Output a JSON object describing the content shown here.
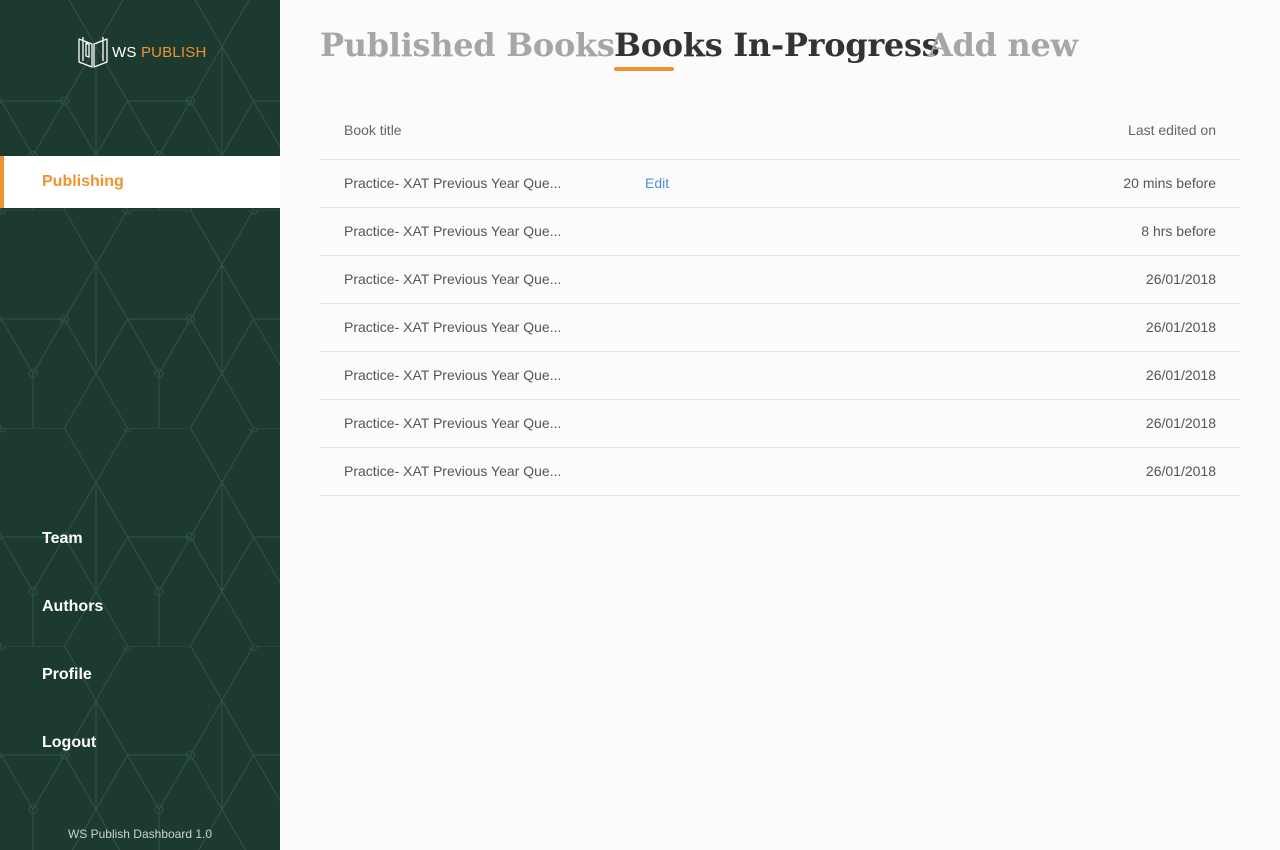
{
  "brand": {
    "logo_prefix": "WS ",
    "logo_accent": "PUBLISH",
    "logo_icon": "open-book-icon",
    "version": "WS Publish Dashboard 1.0"
  },
  "colors": {
    "sidebar": "#1c3a30",
    "accent": "#f0922e",
    "link": "#4a90e2"
  },
  "sidebar": {
    "active_item": "Publishing",
    "items": [
      "Team",
      "Authors",
      "Profile",
      "Logout"
    ]
  },
  "tabs": {
    "published": "Published Books",
    "in_progress": "Books In-Progress",
    "add_new": "Add new",
    "active": "Books In-Progress"
  },
  "table": {
    "headers": {
      "title": "Book title",
      "last_edited": "Last edited on"
    },
    "edit_label": "Edit",
    "rows": [
      {
        "title": "Practice- XAT Previous Year Que...",
        "last_edited": "20 mins before",
        "show_edit": true
      },
      {
        "title": "Practice- XAT Previous Year Que...",
        "last_edited": "8 hrs before",
        "show_edit": false
      },
      {
        "title": "Practice- XAT Previous Year Que...",
        "last_edited": "26/01/2018",
        "show_edit": false
      },
      {
        "title": "Practice- XAT Previous Year Que...",
        "last_edited": "26/01/2018",
        "show_edit": false
      },
      {
        "title": "Practice- XAT Previous Year Que...",
        "last_edited": "26/01/2018",
        "show_edit": false
      },
      {
        "title": "Practice- XAT Previous Year Que...",
        "last_edited": "26/01/2018",
        "show_edit": false
      },
      {
        "title": "Practice- XAT Previous Year Que...",
        "last_edited": "26/01/2018",
        "show_edit": false
      }
    ]
  }
}
